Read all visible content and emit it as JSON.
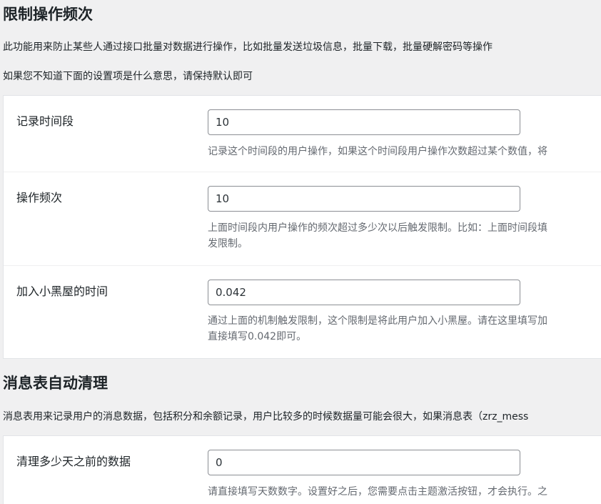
{
  "section1": {
    "title": "限制操作频次",
    "desc1": "此功能用来防止某些人通过接口批量对数据进行操作，比如批量发送垃圾信息，批量下载，批量硬解密码等操作",
    "desc2": "如果您不知道下面的设置项是什么意思，请保持默认即可",
    "rows": [
      {
        "label": "记录时间段",
        "value": "10",
        "help": [
          "记录这个时间段的用户操作，如果这个时间段用户操作次数超过某个数值，将"
        ]
      },
      {
        "label": "操作频次",
        "value": "10",
        "help": [
          "上面时间段内用户操作的频次超过多少次以后触发限制。比如：上面时间段填",
          "发限制。"
        ]
      },
      {
        "label": "加入小黑屋的时间",
        "value": "0.042",
        "help": [
          "通过上面的机制触发限制，这个限制是将此用户加入小黑屋。请在这里填写加",
          "直接填写0.042即可。"
        ]
      }
    ]
  },
  "section2": {
    "title": "消息表自动清理",
    "desc1": "消息表用来记录用户的消息数据，包括积分和余额记录，用户比较多的时候数据量可能会很大，如果消息表（zrz_mess",
    "rows": [
      {
        "label": "清理多少天之前的数据",
        "value": "0",
        "help": [
          "请直接填写天数数字。设置好之后，您需要点击主题激活按钮，才会执行。之"
        ]
      }
    ]
  }
}
